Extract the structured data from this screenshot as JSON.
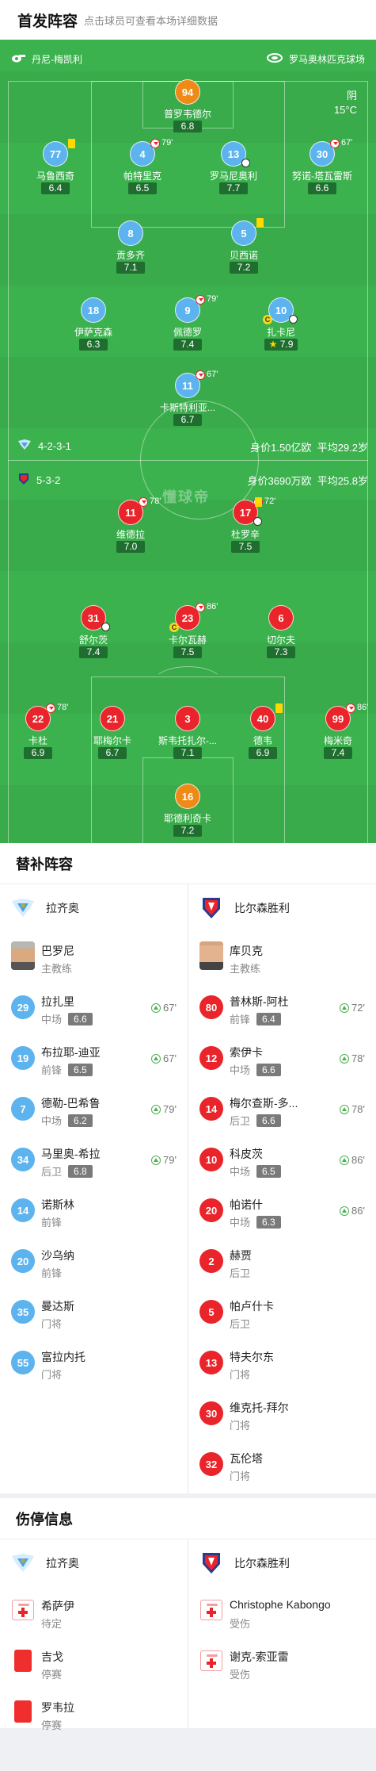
{
  "header": {
    "title": "首发阵容",
    "subtitle": "点击球员可查看本场详细数据"
  },
  "pitch": {
    "referee": "丹尼-梅凯利",
    "stadium": "罗马奥林匹克球场",
    "weather": "阴",
    "temperature": "15°C",
    "watermark": "懂球帝",
    "home": {
      "formation": "4-2-3-1",
      "value": "身价1.50亿欧",
      "age": "平均29.2岁"
    },
    "away": {
      "formation": "5-3-2",
      "value": "身价3690万欧",
      "age": "平均25.8岁"
    },
    "home_players": [
      {
        "num": "94",
        "name": "普罗韦德尔",
        "rating": "6.8",
        "color": "orange"
      },
      {
        "num": "77",
        "name": "马鲁西奇",
        "rating": "6.4",
        "color": "blue",
        "yellow": true
      },
      {
        "num": "4",
        "name": "帕特里克",
        "rating": "6.5",
        "color": "blue",
        "sub": "79'"
      },
      {
        "num": "13",
        "name": "罗马尼奥利",
        "rating": "7.7",
        "color": "blue",
        "ball": true
      },
      {
        "num": "30",
        "name": "努诺-塔瓦雷斯",
        "rating": "6.6",
        "color": "blue",
        "sub": "67'"
      },
      {
        "num": "8",
        "name": "贡多齐",
        "rating": "7.1",
        "color": "blue"
      },
      {
        "num": "5",
        "name": "贝西诺",
        "rating": "7.2",
        "color": "blue",
        "yellow": true
      },
      {
        "num": "18",
        "name": "伊萨克森",
        "rating": "6.3",
        "color": "blue"
      },
      {
        "num": "9",
        "name": "佩德罗",
        "rating": "7.4",
        "color": "blue",
        "sub": "79'"
      },
      {
        "num": "10",
        "name": "扎卡尼",
        "rating": "7.9",
        "color": "blue",
        "captain": true,
        "star": true,
        "ball": true
      },
      {
        "num": "11",
        "name": "卡斯特利亚...",
        "rating": "6.7",
        "color": "blue",
        "sub": "67'"
      }
    ],
    "away_players": [
      {
        "num": "11",
        "name": "维德拉",
        "rating": "7.0",
        "color": "red",
        "sub": "78'"
      },
      {
        "num": "17",
        "name": "杜罗辛",
        "rating": "7.5",
        "color": "red",
        "sub": "72'",
        "yellow": true,
        "ball": true
      },
      {
        "num": "31",
        "name": "舒尔茨",
        "rating": "7.4",
        "color": "red",
        "ball": true
      },
      {
        "num": "23",
        "name": "卡尔瓦赫",
        "rating": "7.5",
        "color": "red",
        "sub": "86'",
        "captain": true
      },
      {
        "num": "6",
        "name": "切尔夫",
        "rating": "7.3",
        "color": "red"
      },
      {
        "num": "22",
        "name": "卡杜",
        "rating": "6.9",
        "color": "red",
        "sub": "78'"
      },
      {
        "num": "21",
        "name": "耶梅尔卡",
        "rating": "6.7",
        "color": "red"
      },
      {
        "num": "3",
        "name": "斯韦托扎尔-...",
        "rating": "7.1",
        "color": "red"
      },
      {
        "num": "40",
        "name": "德韦",
        "rating": "6.9",
        "color": "red",
        "yellow": true
      },
      {
        "num": "99",
        "name": "梅米奇",
        "rating": "7.4",
        "color": "red",
        "sub": "86'"
      },
      {
        "num": "16",
        "name": "耶德利奇卡",
        "rating": "7.2",
        "color": "orange"
      }
    ]
  },
  "subs": {
    "title": "替补阵容",
    "home": {
      "team": "拉齐奥",
      "coach": {
        "name": "巴罗尼",
        "role": "主教练"
      },
      "players": [
        {
          "num": "29",
          "name": "拉扎里",
          "pos": "中场",
          "rating": "6.6",
          "in": "67'"
        },
        {
          "num": "19",
          "name": "布拉耶-迪亚",
          "pos": "前锋",
          "rating": "6.5",
          "in": "67'"
        },
        {
          "num": "7",
          "name": "德勒-巴希鲁",
          "pos": "中场",
          "rating": "6.2",
          "in": "79'"
        },
        {
          "num": "34",
          "name": "马里奥-希拉",
          "pos": "后卫",
          "rating": "6.8",
          "in": "79'"
        },
        {
          "num": "14",
          "name": "诺斯林",
          "pos": "前锋"
        },
        {
          "num": "20",
          "name": "沙乌纳",
          "pos": "前锋"
        },
        {
          "num": "35",
          "name": "曼达斯",
          "pos": "门将"
        },
        {
          "num": "55",
          "name": "富拉内托",
          "pos": "门将"
        }
      ]
    },
    "away": {
      "team": "比尔森胜利",
      "coach": {
        "name": "库贝克",
        "role": "主教练"
      },
      "players": [
        {
          "num": "80",
          "name": "普林斯-阿杜",
          "pos": "前锋",
          "rating": "6.4",
          "in": "72'"
        },
        {
          "num": "12",
          "name": "索伊卡",
          "pos": "中场",
          "rating": "6.6",
          "in": "78'"
        },
        {
          "num": "14",
          "name": "梅尔查斯-多...",
          "pos": "后卫",
          "rating": "6.6",
          "in": "78'"
        },
        {
          "num": "10",
          "name": "科皮茨",
          "pos": "中场",
          "rating": "6.5",
          "in": "86'"
        },
        {
          "num": "20",
          "name": "帕诺什",
          "pos": "中场",
          "rating": "6.3",
          "in": "86'"
        },
        {
          "num": "2",
          "name": "赫贾",
          "pos": "后卫"
        },
        {
          "num": "5",
          "name": "帕卢什卡",
          "pos": "后卫"
        },
        {
          "num": "13",
          "name": "特夫尔东",
          "pos": "门将"
        },
        {
          "num": "30",
          "name": "维克托-拜尔",
          "pos": "门将"
        },
        {
          "num": "32",
          "name": "瓦伦塔",
          "pos": "门将"
        }
      ]
    }
  },
  "injuries": {
    "title": "伤停信息",
    "home": {
      "team": "拉齐奥",
      "players": [
        {
          "name": "希萨伊",
          "status": "待定",
          "icon": "injury"
        },
        {
          "name": "吉戈",
          "status": "停赛",
          "icon": "red-card"
        },
        {
          "name": "罗韦拉",
          "status": "停赛",
          "icon": "red-card"
        }
      ]
    },
    "away": {
      "team": "比尔森胜利",
      "players": [
        {
          "name": "Christophe Kabongo",
          "status": "受伤",
          "icon": "injury"
        },
        {
          "name": "谢克-索亚雷",
          "status": "受伤",
          "icon": "injury"
        }
      ]
    }
  },
  "colors": {
    "pitch": "#3cb24e",
    "home": "#5db3ee",
    "away": "#e9242a",
    "gk": "#f08a16"
  }
}
